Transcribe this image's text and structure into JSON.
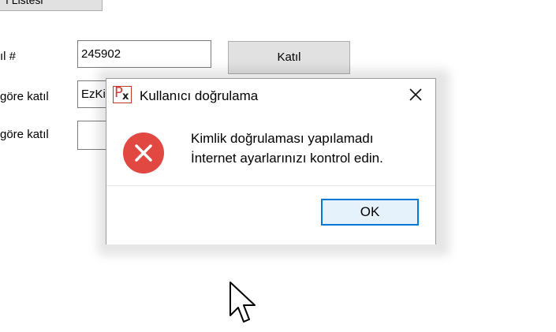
{
  "form": {
    "top_tab_label": "ı Listesi",
    "row1_label": "ıl #",
    "row1_value": "245902",
    "join_button_label": "Katıl",
    "row2_label": "göre katıl",
    "row2_value": "EzKi",
    "row3_label": "göre katıl",
    "row3_value": ""
  },
  "dialog": {
    "title": "Kullanıcı doğrulama",
    "app_icon": "px-app-icon",
    "close_icon": "close-icon",
    "error_icon": "error-icon",
    "message_line1": "Kimlik doğrulaması yapılamadı",
    "message_line2": "İnternet ayarlarınızı kontrol edin.",
    "ok_label": "OK",
    "accent_color": "#0078d7",
    "error_color": "#e04841"
  },
  "cursor": "arrow-cursor-icon"
}
